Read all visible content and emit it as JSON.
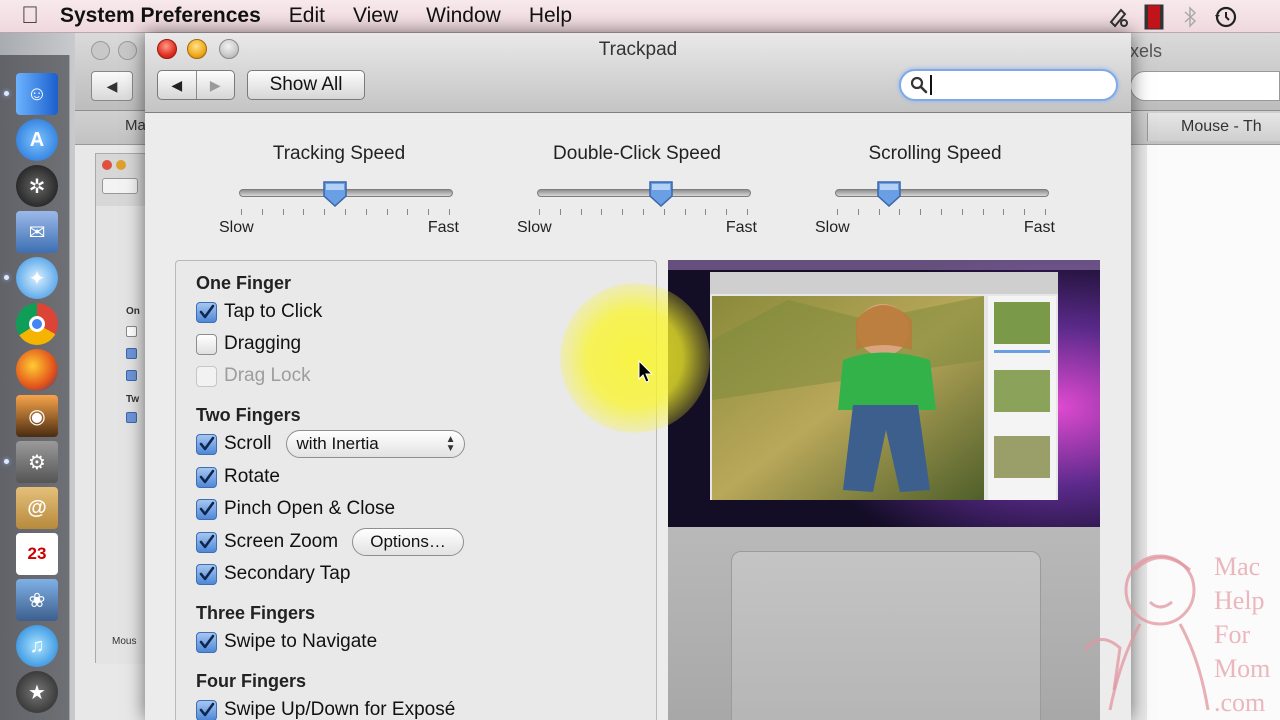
{
  "menubar": {
    "app_name": "System Preferences",
    "items": [
      "Edit",
      "View",
      "Window",
      "Help"
    ]
  },
  "background_window": {
    "title_fragment": "xels",
    "tab_left_fragment": "Ma",
    "tab_right": "Mouse - Th",
    "inner_labels": [
      "On",
      "Tw",
      "Mous"
    ]
  },
  "window": {
    "title": "Trackpad",
    "show_all_label": "Show All",
    "search_value": ""
  },
  "sliders": [
    {
      "title": "Tracking Speed",
      "min_label": "Slow",
      "max_label": "Fast",
      "level": 0.45
    },
    {
      "title": "Double-Click Speed",
      "min_label": "Slow",
      "max_label": "Fast",
      "level": 0.58
    },
    {
      "title": "Scrolling Speed",
      "min_label": "Slow",
      "max_label": "Fast",
      "level": 0.25
    }
  ],
  "options": {
    "one_finger": {
      "heading": "One Finger",
      "tap_to_click": {
        "label": "Tap to Click",
        "checked": true
      },
      "dragging": {
        "label": "Dragging",
        "checked": false
      },
      "drag_lock": {
        "label": "Drag Lock",
        "checked": false,
        "enabled": false
      }
    },
    "two_fingers": {
      "heading": "Two Fingers",
      "scroll": {
        "label": "Scroll",
        "checked": true,
        "popup_value": "with Inertia"
      },
      "rotate": {
        "label": "Rotate",
        "checked": true
      },
      "pinch": {
        "label": "Pinch Open & Close",
        "checked": true
      },
      "screen_zoom": {
        "label": "Screen Zoom",
        "checked": true,
        "options_button": "Options…"
      },
      "secondary_tap": {
        "label": "Secondary Tap",
        "checked": true
      }
    },
    "three_fingers": {
      "heading": "Three Fingers",
      "swipe_navigate": {
        "label": "Swipe to Navigate",
        "checked": true
      }
    },
    "four_fingers": {
      "heading": "Four Fingers",
      "swipe_expose": {
        "label": "Swipe Up/Down for Exposé",
        "checked": true
      }
    }
  },
  "watermark": {
    "lines": [
      "Mac",
      "Help",
      "For",
      "Mom",
      ".com"
    ]
  },
  "colors": {
    "checkbox_blue": "#4f88d8",
    "search_focus": "#7fa9e8",
    "cursor_highlight": "#faf528",
    "close_red": "#e0301f",
    "minimize_yellow": "#f0a91d"
  }
}
